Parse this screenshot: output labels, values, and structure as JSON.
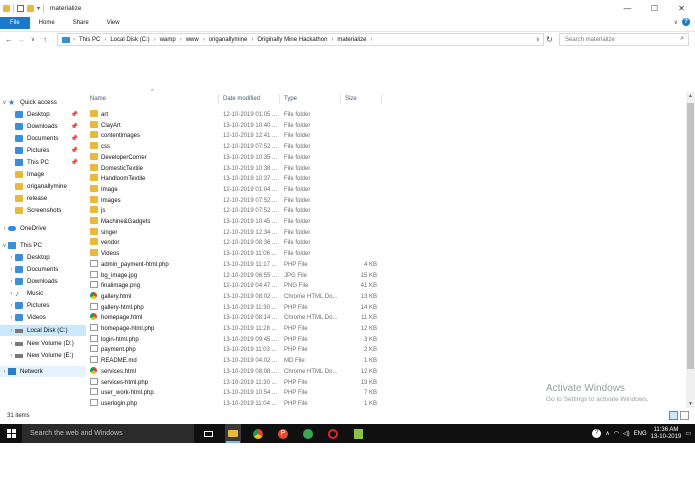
{
  "window": {
    "title": "materialize",
    "controls": [
      "—",
      "☐",
      "✕"
    ]
  },
  "ribbon": {
    "tabs": [
      "File",
      "Home",
      "Share",
      "View"
    ]
  },
  "address": {
    "crumbs": [
      "This PC",
      "Local Disk (C:)",
      "wamp",
      "www",
      "origanallymine",
      "Originally Mine Hackathon",
      "materialize"
    ],
    "search_placeholder": "Search materialize"
  },
  "sidebar": {
    "items": [
      {
        "label": "Quick access",
        "icon": "star-icon",
        "pinned": false
      },
      {
        "label": "Desktop",
        "icon": "desktop-icon",
        "pinned": true
      },
      {
        "label": "Downloads",
        "icon": "downloads-icon",
        "pinned": true
      },
      {
        "label": "Documents",
        "icon": "documents-icon",
        "pinned": true
      },
      {
        "label": "Pictures",
        "icon": "pictures-icon",
        "pinned": true
      },
      {
        "label": "This PC",
        "icon": "pc-icon",
        "pinned": true
      },
      {
        "label": "Image",
        "icon": "folder-icon",
        "pinned": false
      },
      {
        "label": "origanallymine",
        "icon": "folder-icon",
        "pinned": false
      },
      {
        "label": "release",
        "icon": "folder-icon",
        "pinned": false
      },
      {
        "label": "Screenshots",
        "icon": "folder-icon",
        "pinned": false
      },
      {
        "label": "OneDrive",
        "icon": "cloud-icon",
        "pinned": false
      },
      {
        "label": "This PC",
        "icon": "pc-icon",
        "pinned": false
      },
      {
        "label": "Desktop",
        "icon": "desktop-icon",
        "pinned": false
      },
      {
        "label": "Documents",
        "icon": "documents-icon",
        "pinned": false
      },
      {
        "label": "Downloads",
        "icon": "downloads-icon",
        "pinned": false
      },
      {
        "label": "Music",
        "icon": "music-icon",
        "pinned": false
      },
      {
        "label": "Pictures",
        "icon": "pictures-icon",
        "pinned": false
      },
      {
        "label": "Videos",
        "icon": "videos-icon",
        "pinned": false
      },
      {
        "label": "Local Disk (C:)",
        "icon": "drive-icon",
        "pinned": false
      },
      {
        "label": "New Volume (D:)",
        "icon": "drive-icon",
        "pinned": false
      },
      {
        "label": "New Volume (E:)",
        "icon": "drive-icon",
        "pinned": false
      },
      {
        "label": "Network",
        "icon": "network-icon",
        "pinned": false
      }
    ]
  },
  "columns": {
    "name": "Name",
    "date": "Date modified",
    "type": "Type",
    "size": "Size"
  },
  "files": [
    {
      "name": "art",
      "date": "12-10-2019 01:05 ...",
      "type": "File folder",
      "size": "",
      "kind": "folder"
    },
    {
      "name": "ClayArt",
      "date": "13-10-2019 10:40 ...",
      "type": "File folder",
      "size": "",
      "kind": "folder"
    },
    {
      "name": "contentimages",
      "date": "12-10-2019 12:41 ...",
      "type": "File folder",
      "size": "",
      "kind": "folder"
    },
    {
      "name": "css",
      "date": "12-10-2019 07:52 ...",
      "type": "File folder",
      "size": "",
      "kind": "folder"
    },
    {
      "name": "DeveloperCorner",
      "date": "13-10-2019 10:35 ...",
      "type": "File folder",
      "size": "",
      "kind": "folder"
    },
    {
      "name": "DomesticTextile",
      "date": "13-10-2019 10:38 ...",
      "type": "File folder",
      "size": "",
      "kind": "folder"
    },
    {
      "name": "HandloomTextile",
      "date": "13-10-2019 10:37 ...",
      "type": "File folder",
      "size": "",
      "kind": "folder"
    },
    {
      "name": "Image",
      "date": "12-10-2019 01:04 ...",
      "type": "File folder",
      "size": "",
      "kind": "folder"
    },
    {
      "name": "Images",
      "date": "12-10-2019 07:52 ...",
      "type": "File folder",
      "size": "",
      "kind": "folder"
    },
    {
      "name": "js",
      "date": "12-10-2019 07:52 ...",
      "type": "File folder",
      "size": "",
      "kind": "folder"
    },
    {
      "name": "Machine&Gadgets",
      "date": "13-10-2019 10:45 ...",
      "type": "File folder",
      "size": "",
      "kind": "folder"
    },
    {
      "name": "singer",
      "date": "12-10-2019 12:34 ...",
      "type": "File folder",
      "size": "",
      "kind": "folder"
    },
    {
      "name": "vendor",
      "date": "12-10-2019 08:36 ...",
      "type": "File folder",
      "size": "",
      "kind": "folder"
    },
    {
      "name": "Videos",
      "date": "13-10-2019 11:06 ...",
      "type": "File folder",
      "size": "",
      "kind": "folder"
    },
    {
      "name": "admin_payment-html.php",
      "date": "13-10-2019 11:17 ...",
      "type": "PHP File",
      "size": "4 KB",
      "kind": "php"
    },
    {
      "name": "bg_image.jpg",
      "date": "12-10-2019 06:55 ...",
      "type": "JPG File",
      "size": "15 KB",
      "kind": "jpg"
    },
    {
      "name": "finalimage.png",
      "date": "12-10-2019 04:47 ...",
      "type": "PNG File",
      "size": "41 KB",
      "kind": "png"
    },
    {
      "name": "gallery.html",
      "date": "13-10-2019 08:02 ...",
      "type": "Chrome HTML Do...",
      "size": "13 KB",
      "kind": "chrome"
    },
    {
      "name": "gallery-html.php",
      "date": "13-10-2019 11:30 ...",
      "type": "PHP File",
      "size": "14 KB",
      "kind": "php"
    },
    {
      "name": "homepage.html",
      "date": "13-10-2019 08:14 ...",
      "type": "Chrome HTML Do...",
      "size": "11 KB",
      "kind": "chrome"
    },
    {
      "name": "homepage-html.php",
      "date": "13-10-2019 11:28 ...",
      "type": "PHP File",
      "size": "12 KB",
      "kind": "php"
    },
    {
      "name": "login-html.php",
      "date": "13-10-2019 09:45 ...",
      "type": "PHP File",
      "size": "3 KB",
      "kind": "php"
    },
    {
      "name": "payment.php",
      "date": "13-10-2019 11:03 ...",
      "type": "PHP File",
      "size": "2 KB",
      "kind": "php"
    },
    {
      "name": "README.md",
      "date": "13-10-2019 04:02 ...",
      "type": "MD File",
      "size": "1 KB",
      "kind": "md"
    },
    {
      "name": "services.html",
      "date": "13-10-2019 08:08 ...",
      "type": "Chrome HTML Do...",
      "size": "12 KB",
      "kind": "chrome"
    },
    {
      "name": "services-html.php",
      "date": "13-10-2019 11:30 ...",
      "type": "PHP File",
      "size": "13 KB",
      "kind": "php"
    },
    {
      "name": "user_work-html.php",
      "date": "13-10-2019 10:54 ...",
      "type": "PHP File",
      "size": "7 KB",
      "kind": "php"
    },
    {
      "name": "userlogin.php",
      "date": "13-10-2019 11:04 ...",
      "type": "PHP File",
      "size": "1 KB",
      "kind": "php"
    }
  ],
  "status": {
    "count": "31 items"
  },
  "watermark": {
    "title": "Activate Windows",
    "subtitle": "Go to Settings to activate Windows."
  },
  "taskbar": {
    "search_placeholder": "Search the web and Windows",
    "time": "11:36 AM",
    "date": "13-10-2019",
    "apps": [
      "task-view-icon",
      "file-explorer-icon",
      "chrome-icon",
      "app-p-icon",
      "app-globe-icon",
      "opera-icon",
      "app-green-icon"
    ]
  },
  "colors": {
    "accent": "#1979ca",
    "folder": "#e8b93b",
    "taskbar": "#101010"
  }
}
